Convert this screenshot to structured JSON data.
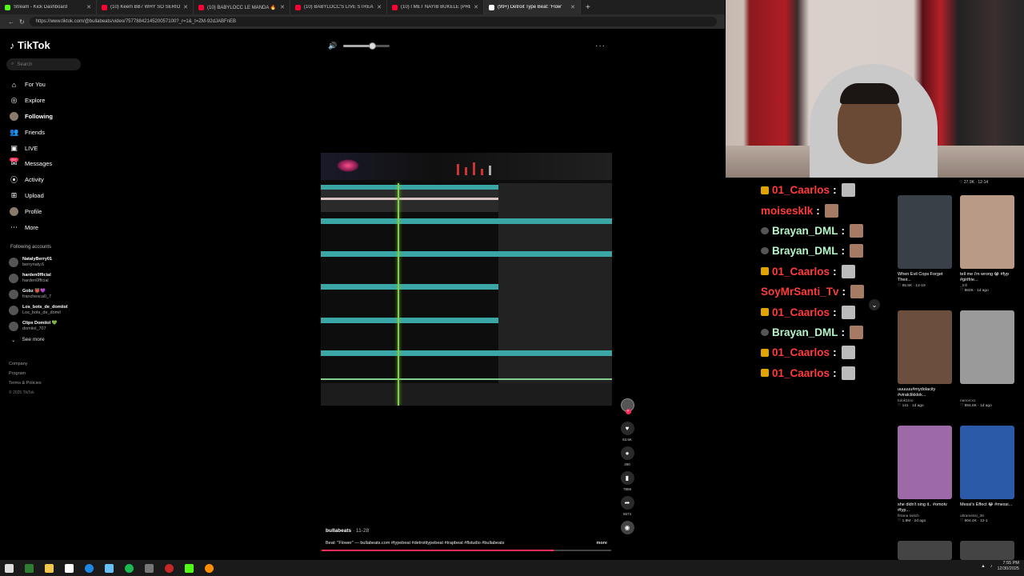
{
  "browser": {
    "tabs": [
      {
        "title": "Stream - Kick Dashboard",
        "color": "#53fc18",
        "active": false
      },
      {
        "title": "(10) Keem BB7 WHY SO SERIOUS",
        "color": "#ff0033",
        "active": false
      },
      {
        "title": "(10) BABYLOCC LE MANDA 🔥🔥",
        "color": "#ff0033",
        "active": false
      },
      {
        "title": "(10) BABYLOCC'S LIVE STREAM R",
        "color": "#ff0033",
        "active": false
      },
      {
        "title": "(10) I MET NAYIB BUKELE (PRESID",
        "color": "#ff0033",
        "active": false
      },
      {
        "title": "(99+) Detroit Type Beat: 'Flow'",
        "color": "#ffffff",
        "active": true
      }
    ],
    "url": "https://www.tiktok.com/@bullabeats/video/7577884214520057100?_r=1&_t=ZM-92dJABFnEB"
  },
  "tiktok": {
    "logo": "TikTok",
    "search_placeholder": "Search",
    "menu": [
      {
        "label": "For You",
        "icon": "home-icon"
      },
      {
        "label": "Explore",
        "icon": "compass-icon"
      },
      {
        "label": "Following",
        "icon": "avatar"
      },
      {
        "label": "Friends",
        "icon": "friends-icon"
      },
      {
        "label": "LIVE",
        "icon": "live-icon"
      },
      {
        "label": "Messages",
        "icon": "messages-icon"
      },
      {
        "label": "Activity",
        "icon": "activity-icon"
      },
      {
        "label": "Upload",
        "icon": "upload-icon"
      },
      {
        "label": "Profile",
        "icon": "avatar"
      },
      {
        "label": "More",
        "icon": "more-icon"
      }
    ],
    "messages_badge": "99+",
    "following_title": "Following accounts",
    "following": [
      {
        "name": "NatalyBerry01",
        "handle": "berrynaty.6"
      },
      {
        "name": "harden0fficial",
        "handle": "harden0fficial"
      },
      {
        "name": "Gobz 👹💜",
        "handle": "franchesca0_7"
      },
      {
        "name": "Los_bots_de_domiiol",
        "handle": "Los_bots_de_domil"
      },
      {
        "name": "Clips Domiiol 💚",
        "handle": "domiiol_707"
      }
    ],
    "see_more": "See more",
    "footer": [
      "Company",
      "Program",
      "Terms & Policies"
    ],
    "copyright": "© 2025 TikTok",
    "volume_fraction": 0.62,
    "post": {
      "author": "bullabeats",
      "date": " · 11-28",
      "description": "Beat: \"Flower\" — bullabeats.com #typebeat #detroittypebeat #trapbeat #flstudio #bullabeats",
      "more": "more",
      "progress_fraction": 0.8
    },
    "actions": [
      {
        "icon": "heart-icon",
        "count": "53.5K"
      },
      {
        "icon": "comment-icon",
        "count": "490"
      },
      {
        "icon": "bookmark-icon",
        "count": "7856"
      },
      {
        "icon": "share-icon",
        "count": "5674"
      }
    ]
  },
  "chat": [
    {
      "user": "01_Caarlos",
      "color": "#ff3b3b",
      "badge": "crown",
      "avatar": "gray"
    },
    {
      "user": "moisesklk",
      "color": "#ff3b3b",
      "badge": "none",
      "avatar": "warm"
    },
    {
      "user": "Brayan_DML",
      "color": "#b6f5c8",
      "badge": "ring",
      "avatar": "warm"
    },
    {
      "user": "Brayan_DML",
      "color": "#b6f5c8",
      "badge": "ring",
      "avatar": "warm"
    },
    {
      "user": "01_Caarlos",
      "color": "#ff3b3b",
      "badge": "crown",
      "avatar": "gray"
    },
    {
      "user": "SoyMrSanti_Tv",
      "color": "#ff3b3b",
      "badge": "none",
      "avatar": "warm"
    },
    {
      "user": "01_Caarlos",
      "color": "#ff3b3b",
      "badge": "crown",
      "avatar": "gray"
    },
    {
      "user": "Brayan_DML",
      "color": "#b6f5c8",
      "badge": "ring",
      "avatar": "warm"
    },
    {
      "user": "01_Caarlos",
      "color": "#ff3b3b",
      "badge": "crown",
      "avatar": "gray"
    },
    {
      "user": "01_Caarlos",
      "color": "#ff3b3b",
      "badge": "crown",
      "avatar": "gray"
    }
  ],
  "grid_top_meta": "♡ 27.9K · 12-14",
  "grid": [
    {
      "title": "When Evil Cops Forget Their...",
      "author": "",
      "stats": "♡ 65.5K · 12-19",
      "color": "#3a4048"
    },
    {
      "title": "tell me i'm wrong 😭 #fyp #girlfrie...",
      "author": "_trill",
      "stats": "♡ 882K · 1d ago",
      "color": "#b99a86"
    },
    {
      "title": "uuuuuu#mydolacity #viralclikklok...",
      "author": "tulok1too",
      "stats": "♡ 141 · 1d ago",
      "color": "#6b4e3d"
    },
    {
      "title": "",
      "author": "nanoir.xo",
      "stats": "♡ 894.6K · 1d ago",
      "color": "#9a9a9a"
    },
    {
      "title": "she didn't sing it.. #omotv #fyp...",
      "author": "firtana twitch",
      "stats": "♡ 1.8M · 2d ago",
      "color": "#9d6aa7"
    },
    {
      "title": "Messi's Effect 😂 #messi...",
      "author": "ultramessi_36",
      "stats": "♡ 604.4K · 12-1",
      "color": "#2a5aa8"
    }
  ],
  "system": {
    "time": "7:55 PM",
    "date": "12/30/2025"
  }
}
